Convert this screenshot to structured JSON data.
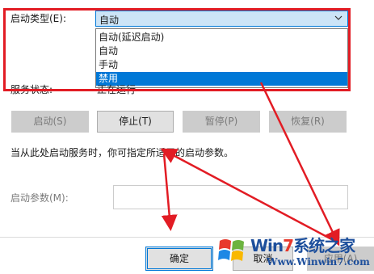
{
  "startup": {
    "label": "启动类型(E):",
    "selected_value": "自动",
    "options": [
      "自动(延迟启动)",
      "自动",
      "手动",
      "禁用"
    ],
    "highlighted_option": "禁用"
  },
  "status": {
    "label": "服务状态:",
    "value": "正在运行"
  },
  "service_buttons": {
    "start": "启动(S)",
    "stop": "停止(T)",
    "pause": "暂停(P)",
    "resume": "恢复(R)"
  },
  "hint": "当从此处启动服务时，你可指定所适用的启动参数。",
  "params": {
    "label": "启动参数(M):",
    "value": ""
  },
  "footer": {
    "ok": "确定",
    "cancel": "取消",
    "apply": "应用(A)"
  },
  "watermark": {
    "brand_prefix": "Win",
    "brand_seven": "7",
    "brand_suffix": "系统之家",
    "url": "Www.Winwin7.com"
  },
  "colors": {
    "annotation_red": "#e21c24",
    "selection_blue": "#0078d7",
    "watermark_blue": "#1d4f9c"
  }
}
